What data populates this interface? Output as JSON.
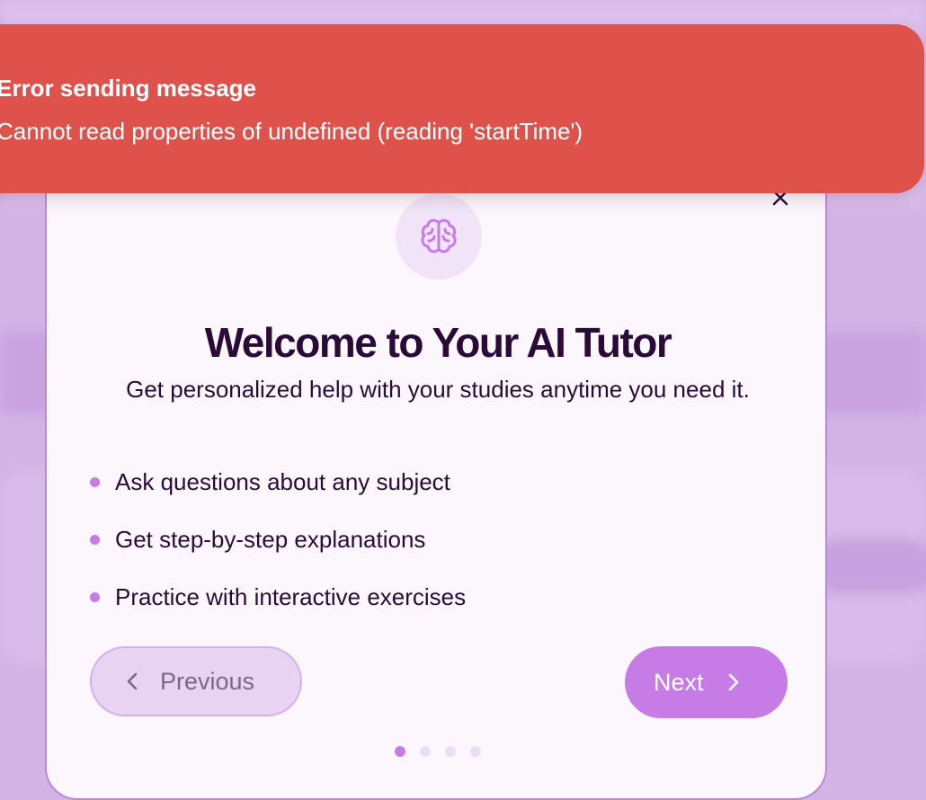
{
  "toast": {
    "title": "Error sending message",
    "message": "Cannot read properties of undefined (reading 'startTime')",
    "color": "#df524c"
  },
  "modal": {
    "close_icon": "close-icon",
    "hero_icon": "brain-icon",
    "title": "Welcome to Your AI Tutor",
    "subtitle": "Get personalized help with your studies anytime you need it.",
    "features": [
      "Ask questions about any subject",
      "Get step-by-step explanations",
      "Practice with interactive exercises"
    ],
    "previous_label": "Previous",
    "next_label": "Next",
    "step_count": 4,
    "active_step": 1
  },
  "colors": {
    "accent": "#c67be6",
    "heading": "#2a0a36",
    "background": "#d3b3e6"
  }
}
